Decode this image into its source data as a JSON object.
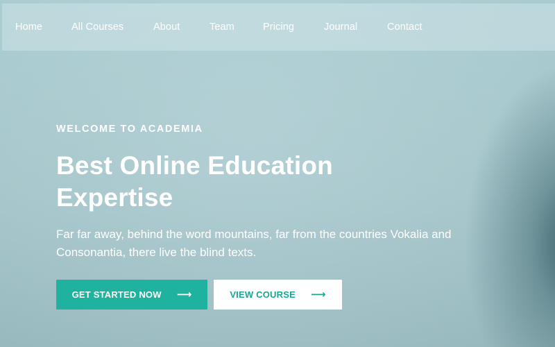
{
  "nav": {
    "items": [
      {
        "label": "Home"
      },
      {
        "label": "All Courses"
      },
      {
        "label": "About"
      },
      {
        "label": "Team"
      },
      {
        "label": "Pricing"
      },
      {
        "label": "Journal"
      },
      {
        "label": "Contact"
      }
    ]
  },
  "hero": {
    "eyebrow": "WELCOME TO ACADEMIA",
    "title_line1": "Best Online Education",
    "title_line2": "Expertise",
    "description_line1": "Far far away, behind the word mountains, far from the countries Vokalia and",
    "description_line2": "Consonantia, there live the blind texts.",
    "primary_button": {
      "label": "GET STARTED NOW",
      "icon": "arrow-right-icon"
    },
    "secondary_button": {
      "label": "VIEW COURSE",
      "icon": "arrow-right-icon"
    }
  },
  "colors": {
    "accent": "#1fb29e",
    "background": "#a9c9ce",
    "text": "#ffffff"
  }
}
